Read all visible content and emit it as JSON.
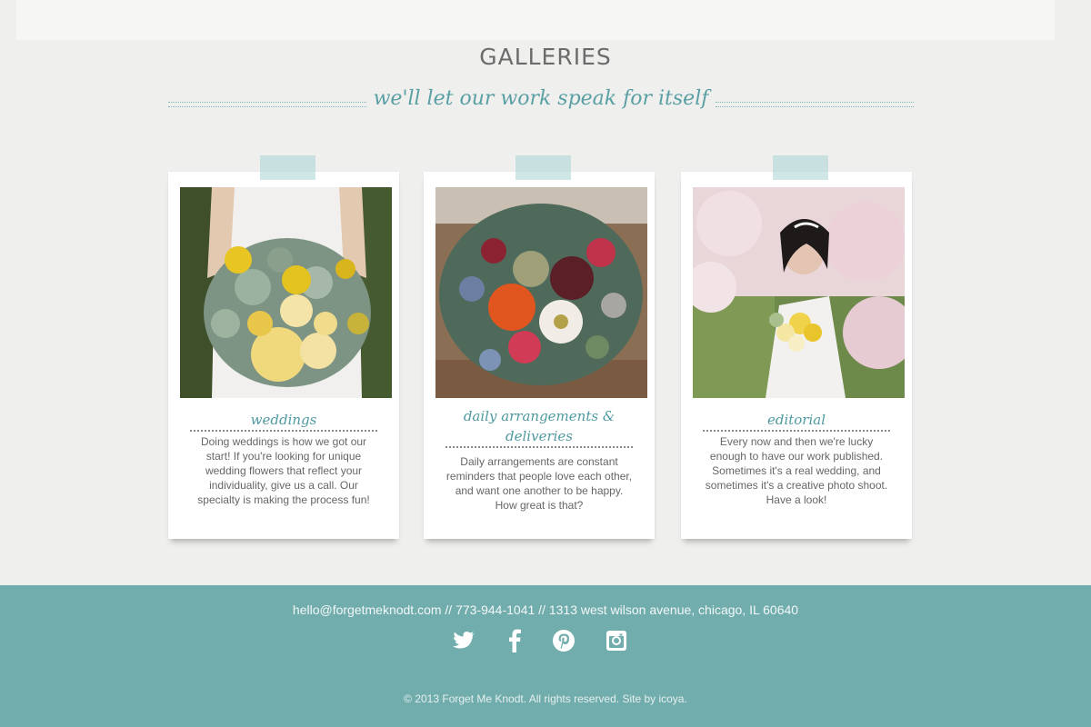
{
  "header": {
    "title": "GALLERIES",
    "tagline": "we'll let our work speak for itself"
  },
  "galleries": [
    {
      "title_lines": [
        "weddings"
      ],
      "description_lines": [
        "Doing weddings is how we got our",
        "start! If you're looking for unique",
        "wedding flowers that reflect your",
        "individuality, give us a call. Our",
        "specialty is making the process fun!"
      ]
    },
    {
      "title_lines": [
        "daily arrangements &",
        "deliveries"
      ],
      "description_lines": [
        "Daily arrangements are constant",
        "reminders that people love each other,",
        "and want one another to be happy.",
        "How great is that?"
      ]
    },
    {
      "title_lines": [
        "editorial"
      ],
      "description_lines": [
        "Every now and then we're lucky",
        "enough to have our work published.",
        "Sometimes it's a real wedding, and",
        "sometimes it's a creative photo shoot.",
        "Have a look!"
      ]
    }
  ],
  "footer": {
    "email": "hello@forgetmeknodt.com",
    "separator": "//",
    "phone": "773-944-1041",
    "address": "1313 west wilson avenue, chicago, IL 60640",
    "social": [
      "twitter-icon",
      "facebook-icon",
      "pinterest-icon",
      "instagram-icon"
    ],
    "copyright": "© 2013 Forget Me Knodt. All rights reserved. Site by icoya."
  },
  "colors": {
    "accent": "#5a9fa4",
    "footer_bg": "#72adad",
    "page_bg": "#efefee"
  }
}
